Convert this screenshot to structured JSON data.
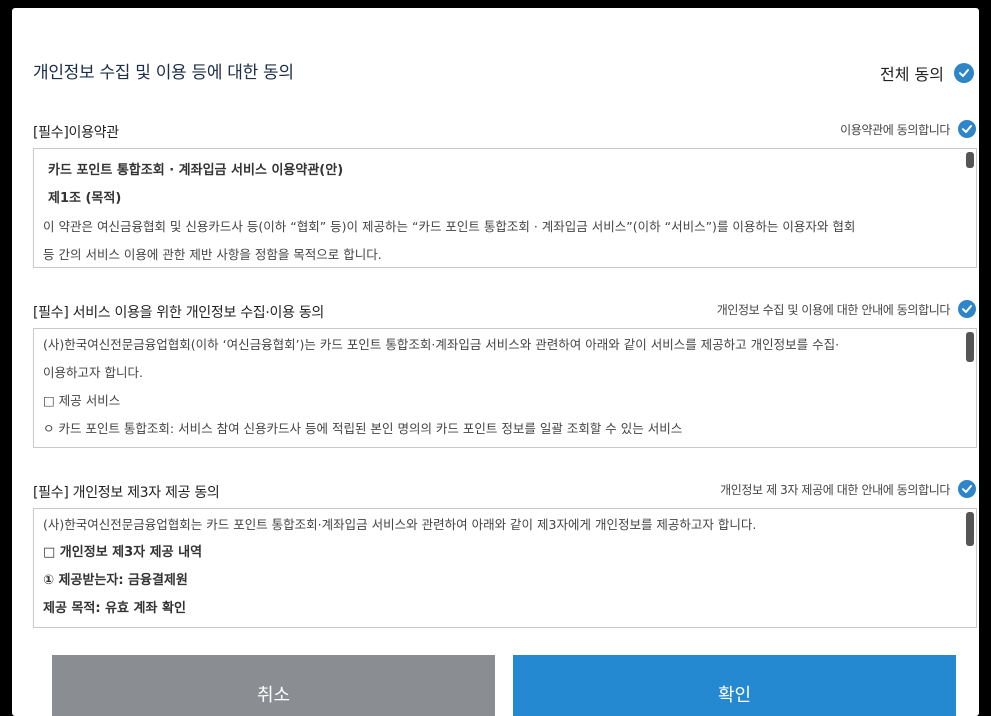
{
  "dialog": {
    "title": "개인정보 수집 및 이용 등에 대한 동의",
    "all_agree_label": "전체 동의"
  },
  "sections": [
    {
      "title": "[필수]이용약관",
      "agree_label": "이용약관에 동의합니다",
      "lines": [
        "카드 포인트 통합조회 · 계좌입금 서비스 이용약관(안)",
        "제1조 (목적)",
        "이 약관은 여신금융협회 및 신용카드사 등(이하 “협회” 등)이 제공하는 “카드 포인트 통합조회 · 계좌입금 서비스”(이하 “서비스”)를 이용하는 이용자와 협회",
        "등 간의 서비스 이용에 관한 제반 사항을 정함을 목적으로 합니다."
      ]
    },
    {
      "title": "[필수] 서비스 이용을 위한 개인정보 수집·이용 동의",
      "agree_label": "개인정보 수집 및 이용에 대한 안내에 동의합니다",
      "lines": [
        "(사)한국여신전문금융업협회(이하 ‘여신금융협회’)는 카드 포인트 통합조회·계좌입금 서비스와 관련하여 아래와 같이 서비스를 제공하고 개인정보를 수집·",
        "이용하고자 합니다.",
        "□ 제공 서비스",
        "ㅇ 카드 포인트 통합조회: 서비스 참여 신용카드사 등에 적립된 본인 명의의 카드 포인트 정보를 일괄 조회할 수 있는 서비스"
      ]
    },
    {
      "title": "[필수] 개인정보 제3자 제공 동의",
      "agree_label": "개인정보 제 3자 제공에 대한 안내에 동의합니다",
      "lines": [
        "(사)한국여신전문금융업협회는 카드 포인트 통합조회·계좌입금 서비스와 관련하여 아래와 같이 제3자에게 개인정보를 제공하고자 합니다.",
        "□ 개인정보 제3자 제공 내역",
        "① 제공받는자: 금융결제원",
        "제공 목적: 유효 계좌 확인"
      ]
    }
  ],
  "buttons": {
    "cancel": "취소",
    "ok": "확인"
  },
  "colors": {
    "accent": "#2e86c9",
    "ok_button": "#2489d1",
    "cancel_button": "#8a8e93"
  }
}
